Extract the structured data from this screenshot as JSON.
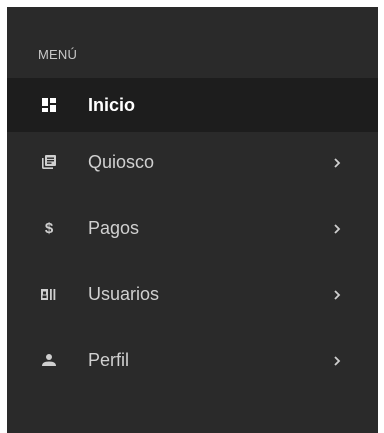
{
  "menu": {
    "section_title": "MENÚ",
    "items": [
      {
        "label": "Inicio",
        "icon": "dashboard-icon",
        "active": true,
        "has_submenu": false
      },
      {
        "label": "Quiosco",
        "icon": "library-books-icon",
        "active": false,
        "has_submenu": true
      },
      {
        "label": "Pagos",
        "icon": "dollar-icon",
        "active": false,
        "has_submenu": true
      },
      {
        "label": "Usuarios",
        "icon": "id-card-icon",
        "active": false,
        "has_submenu": true
      },
      {
        "label": "Perfil",
        "icon": "person-icon",
        "active": false,
        "has_submenu": true
      }
    ],
    "dollar_glyph": "$"
  },
  "colors": {
    "sidebar_bg": "#2a2a2a",
    "active_bg": "#1d1d1d",
    "text": "#d0d0d0",
    "active_text": "#ffffff"
  }
}
